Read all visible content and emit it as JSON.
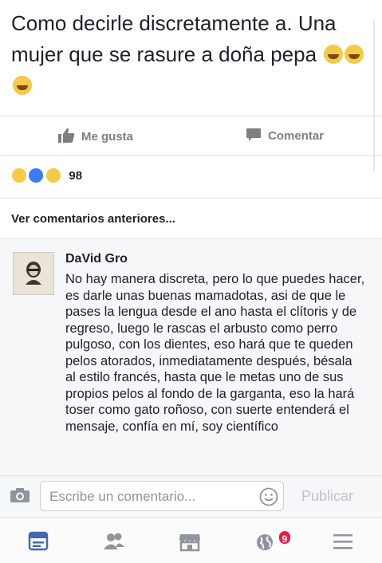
{
  "post": {
    "text": "Como decirle discretamente a. Una mujer que se rasure a doña pepa",
    "emoji": [
      "laughing-tears",
      "sweat-smile",
      "sweat-smile"
    ]
  },
  "actions": {
    "like_label": "Me gusta",
    "comment_label": "Comentar"
  },
  "reactions": {
    "types": [
      "haha",
      "like",
      "wow"
    ],
    "count": "98"
  },
  "comments": {
    "previous_label": "Ver comentarios anteriores...",
    "items": [
      {
        "author": "DaVid Gro",
        "text": "No hay manera discreta, pero lo que puedes hacer, es darle unas buenas mamadotas, asi de que le pases la lengua desde el ano hasta el clítoris y de regreso, luego le rascas el arbusto como perro pulgoso, con los dientes, eso hará que te queden pelos atorados, inmediatamente después, bésala al estilo francés, hasta que le metas uno de sus propios pelos al fondo de la garganta, eso la hará toser como gato roñoso, con suerte entenderá el mensaje, confía en mí, soy científico"
      }
    ]
  },
  "composer": {
    "placeholder": "Escribe un comentario...",
    "publish_label": "Publicar"
  },
  "tabbar": {
    "notification_count": "9",
    "items": [
      "news-feed",
      "friends",
      "marketplace",
      "notifications",
      "menu"
    ]
  },
  "colors": {
    "accent": "#4267b2",
    "badge": "#e41e3f",
    "muted": "#7f7f7f"
  }
}
